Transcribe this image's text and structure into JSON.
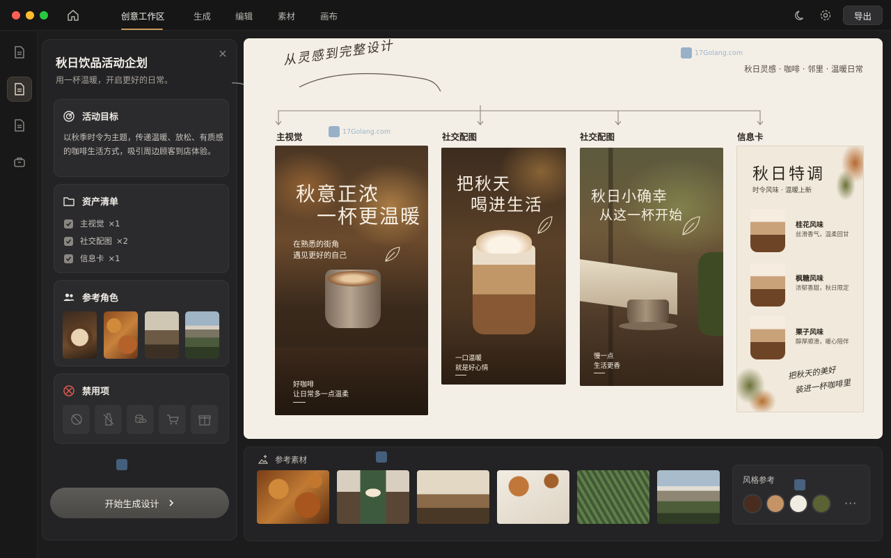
{
  "titlebar": {
    "tabs": [
      "创意工作区",
      "生成",
      "编辑",
      "素材",
      "画布"
    ],
    "export_label": "导出"
  },
  "panel": {
    "title": "秋日饮品活动企划",
    "subtitle": "用一杯温暖，开启更好的日常。",
    "goal": {
      "heading": "活动目标",
      "text": "以秋季时令为主题，传递温暖、放松、有质感的咖啡生活方式，吸引周边顾客到店体验。"
    },
    "assets": {
      "heading": "资产清单",
      "items": [
        {
          "label": "主视觉",
          "count": "×1"
        },
        {
          "label": "社交配图",
          "count": "×2"
        },
        {
          "label": "信息卡",
          "count": "×1"
        }
      ]
    },
    "reference": {
      "heading": "参考角色"
    },
    "banned": {
      "heading": "禁用项"
    },
    "generate_label": "开始生成设计"
  },
  "canvas": {
    "script_title": "从灵感到完整设计",
    "tagline": "秋日灵感 · 咖啡 · 邻里 · 温暖日常",
    "watermark": "17Golang.com",
    "columns": [
      "主视觉",
      "社交配图",
      "社交配图",
      "信息卡"
    ],
    "poster1": {
      "headline1": "秋意正浓",
      "headline2": "一杯更温暖",
      "sub1": "在熟悉的街角",
      "sub2": "遇见更好的自己",
      "foot1": "好咖啡",
      "foot2": "让日常多一点温柔"
    },
    "poster2": {
      "headline1": "把秋天",
      "headline2": "喝进生活",
      "foot1": "一口温暖",
      "foot2": "就是好心情"
    },
    "poster3": {
      "headline1": "秋日小确幸",
      "headline2": "从这一杯开始",
      "foot1": "慢一点",
      "foot2": "生活更香"
    },
    "infocard": {
      "title": "秋日特调",
      "subtitle": "时令风味 · 温暖上新",
      "items": [
        {
          "name": "桂花风味",
          "desc": "丝滑香气，温柔回甘"
        },
        {
          "name": "枫糖风味",
          "desc": "浓郁香甜，秋日限定"
        },
        {
          "name": "栗子风味",
          "desc": "醇厚顺滑，暖心陪伴"
        }
      ],
      "footer1": "把秋天的美好",
      "footer2": "装进一杯咖啡里"
    }
  },
  "strip": {
    "title": "参考素材",
    "style_title": "风格参考",
    "swatches": [
      "#4a2c1e",
      "#c49467",
      "#f1ece2",
      "#5b6233"
    ],
    "more": "···"
  },
  "colors": {
    "accent": "#c99a5b",
    "canvas_bg": "#f4efe6"
  }
}
